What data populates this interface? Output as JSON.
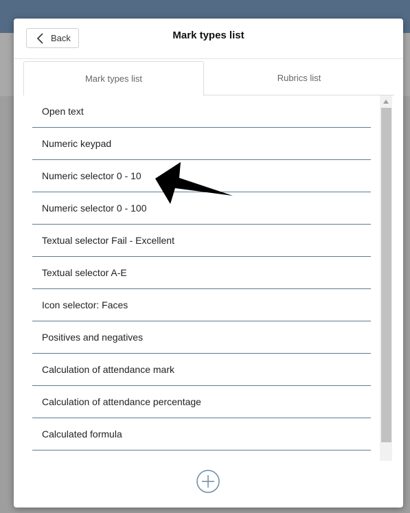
{
  "header": {
    "back_label": "Back",
    "title": "Mark types list"
  },
  "tabs": [
    {
      "label": "Mark types list",
      "active": true
    },
    {
      "label": "Rubrics list",
      "active": false
    }
  ],
  "list": {
    "items": [
      "Open text",
      "Numeric keypad",
      "Numeric selector 0 - 10",
      "Numeric selector 0 - 100",
      "Textual selector Fail - Excellent",
      "Textual selector A-E",
      "Icon selector: Faces",
      "Positives and negatives",
      "Calculation of attendance mark",
      "Calculation of attendance percentage",
      "Calculated formula"
    ]
  },
  "icons": {
    "back": "chevron-left-icon",
    "add": "plus-circle-icon",
    "scroll_up": "triangle-up-icon",
    "annotation": "arrow-pointer-icon"
  },
  "colors": {
    "topbar": "#536b85",
    "divider": "#5a7c95",
    "add_icon": "#6a8aa6"
  }
}
